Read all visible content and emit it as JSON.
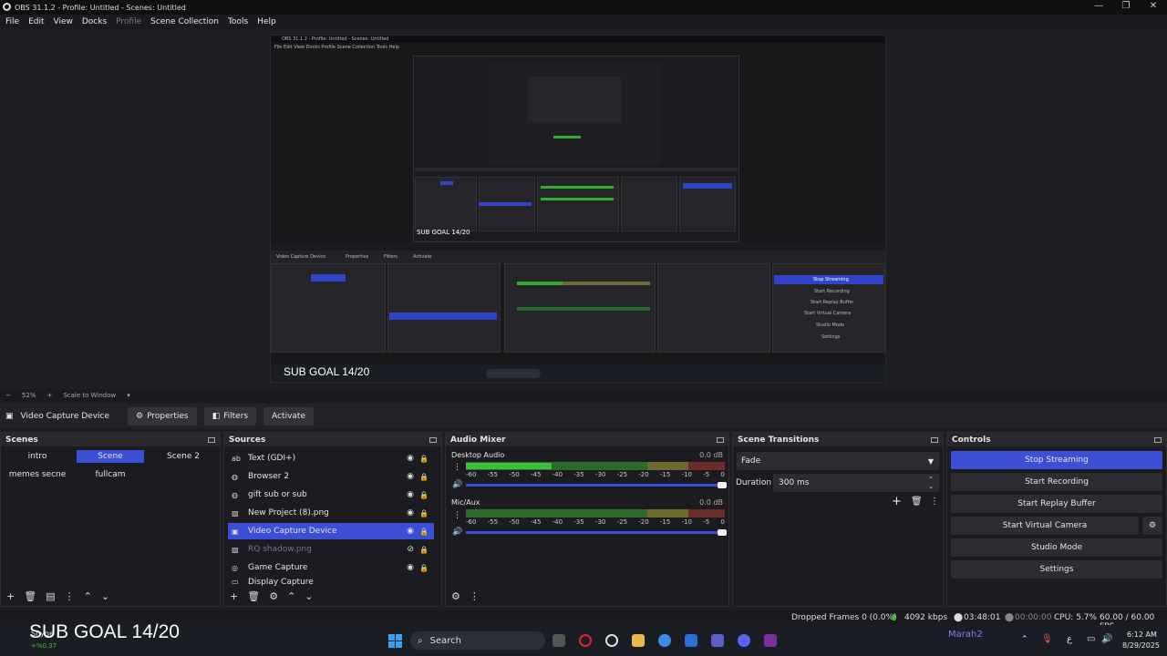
{
  "window": {
    "title": "OBS 31.1.2 - Profile: Untitled - Scenes: Untitled",
    "controls": [
      "—",
      "❐",
      "✕"
    ]
  },
  "menu": [
    "File",
    "Edit",
    "View",
    "Docks",
    "Profile",
    "Scene Collection",
    "Tools",
    "Help"
  ],
  "preview": {
    "zoom": "52%",
    "zoom_add": "+",
    "scale_mode": "Scale to Window",
    "overlay_text": "SUB GOAL 14/20",
    "inner_title": "OBS 31.1.2 - Profile: Untitled - Scenes: Untitled",
    "inner_menu": "File  Edit  View  Docks  Profile  Scene Collection  Tools  Help",
    "inner_buttons": [
      "Video Capture Device",
      "Properties",
      "Filters",
      "Activate"
    ],
    "inner_controls": [
      "Stop Streaming",
      "Start Recording",
      "Start Replay Buffer",
      "Start Virtual Camera",
      "Studio Mode",
      "Settings"
    ]
  },
  "source_toolbar": {
    "selected": "Video Capture Device",
    "properties": "Properties",
    "filters": "Filters",
    "activate": "Activate"
  },
  "scenes": {
    "title": "Scenes",
    "items": [
      "intro",
      "Scene",
      "Scene 2",
      "memes secne",
      "fullcam"
    ],
    "active": "Scene"
  },
  "sources": {
    "title": "Sources",
    "items": [
      {
        "label": "Text (GDI+)",
        "icon": "text-icon"
      },
      {
        "label": "Browser 2",
        "icon": "globe-icon"
      },
      {
        "label": "gift sub or sub",
        "icon": "globe-icon"
      },
      {
        "label": "New Project (8).png",
        "icon": "image-icon"
      },
      {
        "label": "Video Capture Device",
        "icon": "camera-icon"
      },
      {
        "label": "RQ shadow.png",
        "icon": "image-icon"
      },
      {
        "label": "Game Capture",
        "icon": "gamepad-icon"
      },
      {
        "label": "Display Capture",
        "icon": "monitor-icon"
      }
    ]
  },
  "audio_mixer": {
    "title": "Audio Mixer",
    "channels": [
      {
        "name": "Desktop Audio",
        "db": "0.0 dB",
        "level": 0.33,
        "volume": 1.0
      },
      {
        "name": "Mic/Aux",
        "db": "0.0 dB",
        "level": 0.0,
        "volume": 1.0
      }
    ],
    "ticks": [
      "-60",
      "-55",
      "-50",
      "-45",
      "-40",
      "-35",
      "-30",
      "-25",
      "-20",
      "-15",
      "-10",
      "-5",
      "0"
    ]
  },
  "transitions": {
    "title": "Scene Transitions",
    "type": "Fade",
    "duration_label": "Duration",
    "duration": "300 ms"
  },
  "controls": {
    "title": "Controls",
    "buttons": [
      "Stop Streaming",
      "Start Recording",
      "Start Replay Buffer",
      "Start Virtual Camera",
      "Studio Mode",
      "Settings"
    ]
  },
  "status": {
    "dropped": "Dropped Frames 0 (0.0%)",
    "bitrate": "4092 kbps",
    "stream_time": "03:48:01",
    "rec_time": "00:00:00",
    "cpu": "CPU: 5.7%",
    "fps": "60.00 / 60.00 FPS"
  },
  "taskbar": {
    "search": "Search",
    "user": "Marah2",
    "time": "6:12 AM",
    "date": "8/29/2025",
    "stock_name": "Snyge",
    "stock_change": "+%0.37",
    "input_indicator": "ع"
  },
  "colors": {
    "accent": "#3a4fd6",
    "meter_green": "#3fbf3f",
    "meter_yellow": "#c9b432",
    "meter_red": "#b03a3a"
  }
}
